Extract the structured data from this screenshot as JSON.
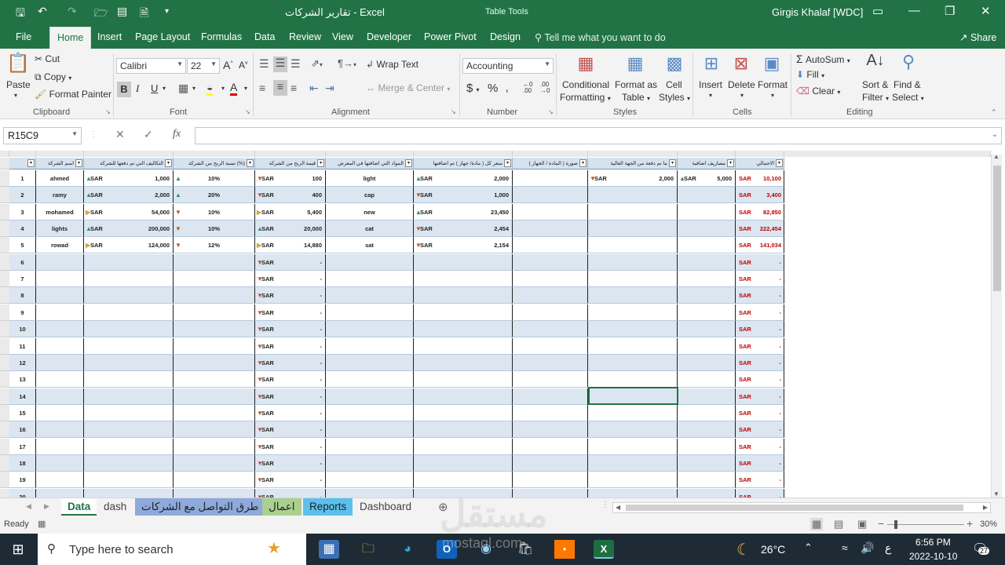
{
  "window": {
    "title": "تقارير الشركات - Excel",
    "context_tab": "Table Tools",
    "user": "Girgis Khalaf [WDC]"
  },
  "ribbon_tabs": [
    "File",
    "Home",
    "Insert",
    "Page Layout",
    "Formulas",
    "Data",
    "Review",
    "View",
    "Developer",
    "Power Pivot",
    "Design"
  ],
  "tell_me": "Tell me what you want to do",
  "share_label": "Share",
  "ribbon": {
    "clipboard": {
      "paste": "Paste",
      "cut": "Cut",
      "copy": "Copy",
      "format_painter": "Format Painter",
      "group": "Clipboard"
    },
    "font": {
      "family": "Calibri",
      "size": "22",
      "group": "Font"
    },
    "alignment": {
      "wrap": "Wrap Text",
      "merge": "Merge & Center",
      "group": "Alignment"
    },
    "number": {
      "format": "Accounting",
      "group": "Number"
    },
    "styles": {
      "cond": "Conditional",
      "cond2": "Formatting",
      "fmt_as": "Format as",
      "fmt_as2": "Table",
      "cell": "Cell",
      "cell2": "Styles",
      "group": "Styles"
    },
    "cells": {
      "insert": "Insert",
      "delete": "Delete",
      "format": "Format",
      "group": "Cells"
    },
    "editing": {
      "autosum": "AutoSum",
      "fill": "Fill",
      "clear": "Clear",
      "sort": "Sort &",
      "sort2": "Filter",
      "find": "Find &",
      "find2": "Select",
      "group": "Editing"
    }
  },
  "formula_bar": {
    "name_box": "R15C9",
    "fx": "fx",
    "value": ""
  },
  "table": {
    "headers": [
      "اسم الشركة",
      "التكاليف التي تم دفعها للشركة",
      "نسبة الربح من الشركة (%)",
      "قيمة الربح من الشركة",
      "المواد التي اضافتها في المعرض",
      "سعر كل ( مادة/ جهاز ) تم اضافتها",
      "صورة ( المادة / الجهاز )",
      "ما تم دفعة من الجهة العالية",
      "مصاريف اضافية",
      "الاجمالي"
    ],
    "currency": "SAR",
    "dash": "-",
    "rows": [
      {
        "n": "1",
        "name": "ahmed",
        "cost": "1,000",
        "pct": "10%",
        "profit": "100",
        "item": "light",
        "price": "2,000",
        "paid": "2,000",
        "extra": "5,000",
        "total": "10,100",
        "f": [
          "up",
          "up",
          "down",
          "up",
          "down",
          "up"
        ]
      },
      {
        "n": "2",
        "name": "ramy",
        "cost": "2,000",
        "pct": "20%",
        "profit": "400",
        "item": "cap",
        "price": "1,000",
        "paid": "",
        "extra": "",
        "total": "3,400",
        "f": [
          "up",
          "up",
          "down",
          "down"
        ]
      },
      {
        "n": "3",
        "name": "mohamed",
        "cost": "54,000",
        "pct": "10%",
        "profit": "5,400",
        "item": "new",
        "price": "23,450",
        "paid": "",
        "extra": "",
        "total": "82,850",
        "f": [
          "side",
          "down",
          "side",
          "up"
        ]
      },
      {
        "n": "4",
        "name": "lights",
        "cost": "200,000",
        "pct": "10%",
        "profit": "20,000",
        "item": "cat",
        "price": "2,454",
        "paid": "",
        "extra": "",
        "total": "222,454",
        "f": [
          "up",
          "down",
          "up",
          "down"
        ]
      },
      {
        "n": "5",
        "name": "rowad",
        "cost": "124,000",
        "pct": "12%",
        "profit": "14,880",
        "item": "sat",
        "price": "2,154",
        "paid": "",
        "extra": "",
        "total": "141,034",
        "f": [
          "side",
          "down",
          "side",
          "down"
        ]
      }
    ],
    "empty_rows": [
      "6",
      "7",
      "8",
      "9",
      "10",
      "11",
      "12",
      "13",
      "14",
      "15",
      "16",
      "17",
      "18",
      "19",
      "20"
    ]
  },
  "sheets": [
    "Data",
    "dash",
    "طرق التواصل مع الشركات",
    "اعمال",
    "Reports",
    "Dashboard"
  ],
  "sheet_colors": {
    "dash": "",
    "طرق التواصل مع الشركات": "#8ea9db",
    "اعمال": "#a9d08e",
    "Reports": "#5bc0eb"
  },
  "status": {
    "ready": "Ready",
    "zoom": "30%"
  },
  "taskbar": {
    "search": "Type here to search",
    "weather": "26°C",
    "lang": "ع",
    "time": "6:56 PM",
    "date": "2022-10-10",
    "notif": "27"
  },
  "watermark": {
    "main": "مستقل",
    "sub": "mostaql.com"
  },
  "colors": {
    "excel_green": "#217346",
    "header_fill": "#d6e3ef",
    "band": "#dce6f1",
    "total_red": "#c00000"
  }
}
